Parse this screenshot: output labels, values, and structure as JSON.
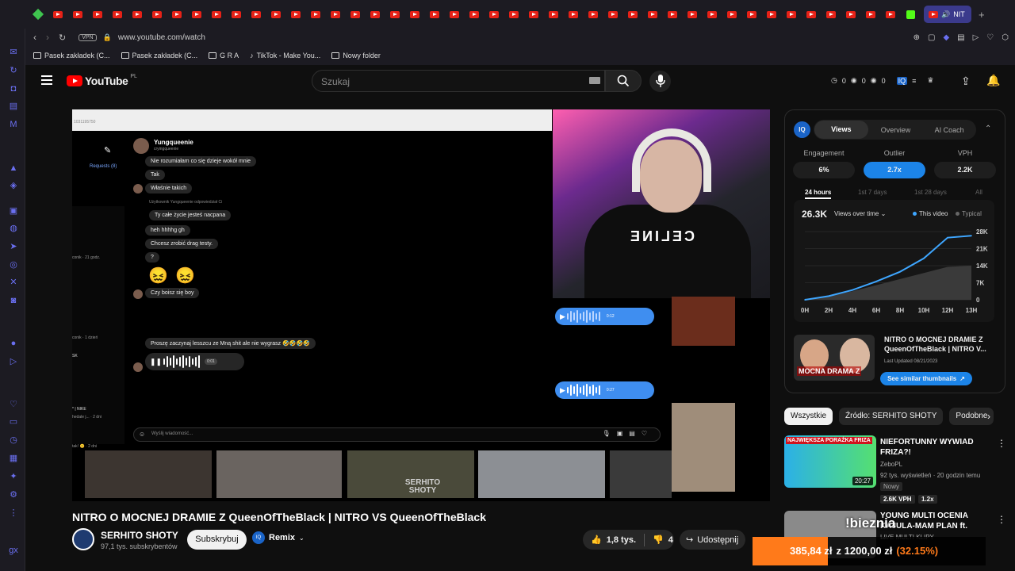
{
  "browser": {
    "url": "www.youtube.com/watch",
    "vpn_label": "VPN",
    "tab_sound_label": "NIT",
    "bookmarks": [
      "Pasek zakładek (C...",
      "Pasek zakładek (C...",
      "G R A",
      "TikTok - Make You...",
      "Nowy folder"
    ]
  },
  "youtube": {
    "logo": "YouTube",
    "region": "PL",
    "search_placeholder": "Szukaj",
    "header_counts": [
      "0",
      "0",
      "0"
    ]
  },
  "video": {
    "title": "NITRO O MOCNEJ DRAMIE Z QueenOfTheBlack | NITRO VS QueenOfTheBlack",
    "channel": "SERHITO SHOTY",
    "subscribers": "97,1 tys. subskrybentów",
    "subscribe_label": "Subskrybuj",
    "remix_label": "Remix",
    "likes": "1,8 tys.",
    "dislikes": "4",
    "share_label": "Udostępnij",
    "watermark": "SERHITO SHOTY",
    "webcam_shirt_text": "CELINE",
    "dm": {
      "username": "Yungqueenie",
      "handle": "cryingqueenie",
      "requests": "Requests (8)",
      "top_bar_text": "1031195750",
      "messages": [
        "Nie rozumiałam co się dzieje wokół mnie",
        "Tak",
        "Właśnie takich",
        "Użytkownik Yungqueenie odpowiedział Ci",
        "Ty całe życie jesteś nacpana",
        "heh hhhhg gh",
        "Chcesz zrobić drag testy.",
        "?",
        "Czy boisz się boy",
        "Proszę zaczynaj lesszcu ze Mną shit ale nie wygrasz 🤣🤣🤣🤣",
        "Wyślij wiadomość..."
      ],
      "voice_durations": [
        "0:12",
        "0:01",
        "0:27"
      ],
      "side_texts": [
        "conik · 21 godz.",
        "conik · 1 dzień",
        "SK",
        "* | NIKE",
        "hedale j... · 2 dni",
        "tak! 😊 · 2 dni"
      ],
      "emojis": [
        "😖",
        "😖"
      ]
    }
  },
  "iq_panel": {
    "badge": "IQ",
    "tabs": [
      "Views",
      "Overview",
      "AI Coach"
    ],
    "active_tab": "Views",
    "stats": [
      {
        "label": "Engagement",
        "value": "6%"
      },
      {
        "label": "Outlier",
        "value": "2.7x"
      },
      {
        "label": "VPH",
        "value": "2.2K"
      }
    ],
    "periods": [
      "24 hours",
      "1st 7 days",
      "1st 28 days",
      "All"
    ],
    "views_total": "26.3K",
    "views_dropdown": "Views over time",
    "legend_this": "This video",
    "legend_typical": "Typical",
    "similar_title": "NITRO O MOCNEJ DRAMIE Z QueenOfTheBlack | NITRO V...",
    "similar_updated": "Last Updated 08/21/2023",
    "similar_button": "See similar thumbnails",
    "similar_thumb_text": "MOCNA DRAMA Z"
  },
  "chart_data": {
    "type": "line",
    "x": [
      "0H",
      "2H",
      "4H",
      "6H",
      "8H",
      "10H",
      "12H",
      "13H"
    ],
    "yticks": [
      "0",
      "7K",
      "14K",
      "21K",
      "28K"
    ],
    "ylim": [
      0,
      28000
    ],
    "series": [
      {
        "name": "This video",
        "values": [
          0,
          1500,
          4000,
          7500,
          11500,
          17000,
          25500,
          26300
        ],
        "color": "#3ea6ff"
      },
      {
        "name": "Typical",
        "values": [
          0,
          1500,
          3500,
          6000,
          8500,
          11000,
          13500,
          14000
        ],
        "color": "#666666"
      }
    ]
  },
  "recommendations": {
    "chips": [
      "Wszystkie",
      "Źródło: SERHITO SHOTY",
      "Podobne"
    ],
    "items": [
      {
        "title": "NIEFORTUNNY WYWIAD FRIZA?!",
        "channel": "ZeboPL",
        "meta": "92 tys. wyświetleń · 20 godzin temu",
        "badge": "Nowy",
        "vph": "2.6K VPH",
        "mult": "1.2x",
        "duration": "20:27",
        "thumb_text": "NAJWIĘKSZA PORAŻKA FRIZA"
      },
      {
        "title": "YOUNG MULTI OCENIA KAJULA-MAM PLAN ft. ...",
        "channel": "LIVE MULTI KLIPY",
        "meta": "...dni temu",
        "thumb_text": "!bieznia"
      }
    ]
  },
  "overlay": {
    "earnings": "385,84 zł",
    "target": "z 1200,00 zł",
    "percent": "(32.15%)"
  }
}
